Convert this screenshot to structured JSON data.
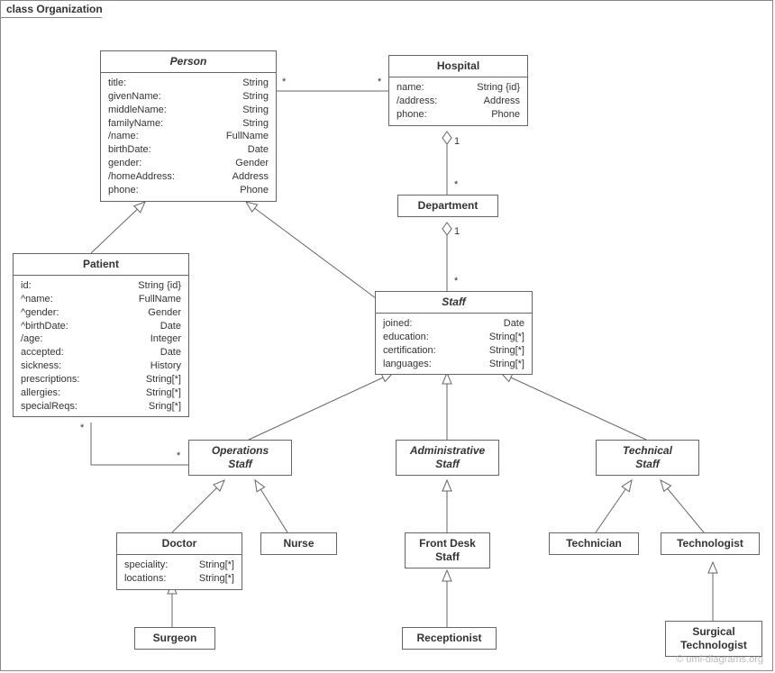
{
  "frame": {
    "title": "class Organization"
  },
  "watermark": "© uml-diagrams.org",
  "classes": {
    "person": {
      "name": "Person",
      "attrs": [
        {
          "k": "title:",
          "v": "String"
        },
        {
          "k": "givenName:",
          "v": "String"
        },
        {
          "k": "middleName:",
          "v": "String"
        },
        {
          "k": "familyName:",
          "v": "String"
        },
        {
          "k": "/name:",
          "v": "FullName"
        },
        {
          "k": "birthDate:",
          "v": "Date"
        },
        {
          "k": "gender:",
          "v": "Gender"
        },
        {
          "k": "/homeAddress:",
          "v": "Address"
        },
        {
          "k": "phone:",
          "v": "Phone"
        }
      ]
    },
    "hospital": {
      "name": "Hospital",
      "attrs": [
        {
          "k": "name:",
          "v": "String {id}"
        },
        {
          "k": "/address:",
          "v": "Address"
        },
        {
          "k": "phone:",
          "v": "Phone"
        }
      ]
    },
    "department": {
      "name": "Department"
    },
    "patient": {
      "name": "Patient",
      "attrs": [
        {
          "k": "id:",
          "v": "String {id}"
        },
        {
          "k": "^name:",
          "v": "FullName"
        },
        {
          "k": "^gender:",
          "v": "Gender"
        },
        {
          "k": "^birthDate:",
          "v": "Date"
        },
        {
          "k": "/age:",
          "v": "Integer"
        },
        {
          "k": "accepted:",
          "v": "Date"
        },
        {
          "k": "sickness:",
          "v": "History"
        },
        {
          "k": "prescriptions:",
          "v": "String[*]"
        },
        {
          "k": "allergies:",
          "v": "String[*]"
        },
        {
          "k": "specialReqs:",
          "v": "Sring[*]"
        }
      ]
    },
    "staff": {
      "name": "Staff",
      "attrs": [
        {
          "k": "joined:",
          "v": "Date"
        },
        {
          "k": "education:",
          "v": "String[*]"
        },
        {
          "k": "certification:",
          "v": "String[*]"
        },
        {
          "k": "languages:",
          "v": "String[*]"
        }
      ]
    },
    "opsStaff": {
      "name": "Operations\nStaff"
    },
    "adminStaff": {
      "name": "Administrative\nStaff"
    },
    "techStaff": {
      "name": "Technical\nStaff"
    },
    "doctor": {
      "name": "Doctor",
      "attrs": [
        {
          "k": "speciality:",
          "v": "String[*]"
        },
        {
          "k": "locations:",
          "v": "String[*]"
        }
      ]
    },
    "nurse": {
      "name": "Nurse"
    },
    "frontDesk": {
      "name": "Front Desk\nStaff"
    },
    "technician": {
      "name": "Technician"
    },
    "technologist": {
      "name": "Technologist"
    },
    "surgeon": {
      "name": "Surgeon"
    },
    "receptionist": {
      "name": "Receptionist"
    },
    "surgTech": {
      "name": "Surgical\nTechnologist"
    }
  },
  "mult": {
    "personHospL": "*",
    "personHospR": "*",
    "hospDept1": "1",
    "hospDeptStar": "*",
    "deptStaff1": "1",
    "deptStaffStar": "*",
    "patientOpsL": "*",
    "patientOpsR": "*"
  }
}
